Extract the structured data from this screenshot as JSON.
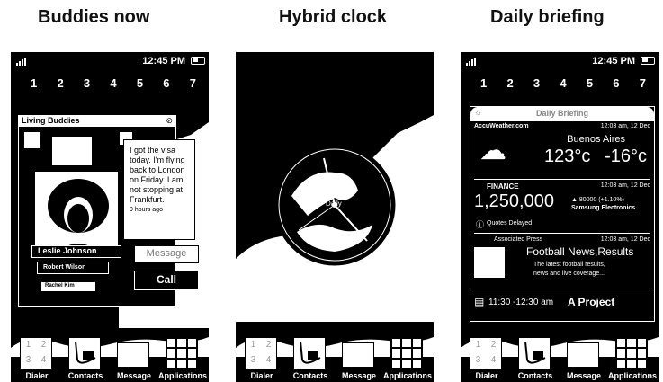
{
  "headings": [
    "Buddies now",
    "Hybrid clock",
    "Daily briefing"
  ],
  "status_bar": {
    "time": "12:45 PM"
  },
  "page_numbers": [
    "1",
    "2",
    "3",
    "4",
    "5",
    "6",
    "7"
  ],
  "dock": {
    "items": [
      "Dialer",
      "Contacts",
      "Message",
      "Applications"
    ],
    "keypad": [
      "1",
      "2",
      "3",
      "4"
    ]
  },
  "buddies": {
    "title": "Living Buddies",
    "message": "I got the visa today. I'm flying back to London on Friday. I am not stopping at Frankfurt.",
    "time_ago": "9 hours ago",
    "message_button": "Message",
    "call_button": "Call",
    "contacts": [
      "Leslie Johnson",
      "Robert Wilson",
      "Rachel Kim"
    ]
  },
  "clock": {
    "label": "Daily"
  },
  "briefing": {
    "title": "Daily Briefing",
    "weather": {
      "source": "AccuWeather.com",
      "timestamp": "12:03 am, 12 Dec",
      "city": "Buenos Aires",
      "temp": "123°c",
      "temp_low": "-16°c"
    },
    "finance": {
      "label": "FINANCE",
      "timestamp": "12:03 am, 12 Dec",
      "value": "1,250,000",
      "change": "▲ 80000 (+1.10%)",
      "company": "Samsung Electronics",
      "note": "Quotes Delayed"
    },
    "news": {
      "source": "Associated Press",
      "timestamp": "12:03 am, 12 Dec",
      "headline": "Football News,Results",
      "summary_1": "The latest football results,",
      "summary_2": "news and live coverage..."
    },
    "calendar": {
      "time": "11:30 -12:30 am",
      "event": "A Project"
    }
  }
}
